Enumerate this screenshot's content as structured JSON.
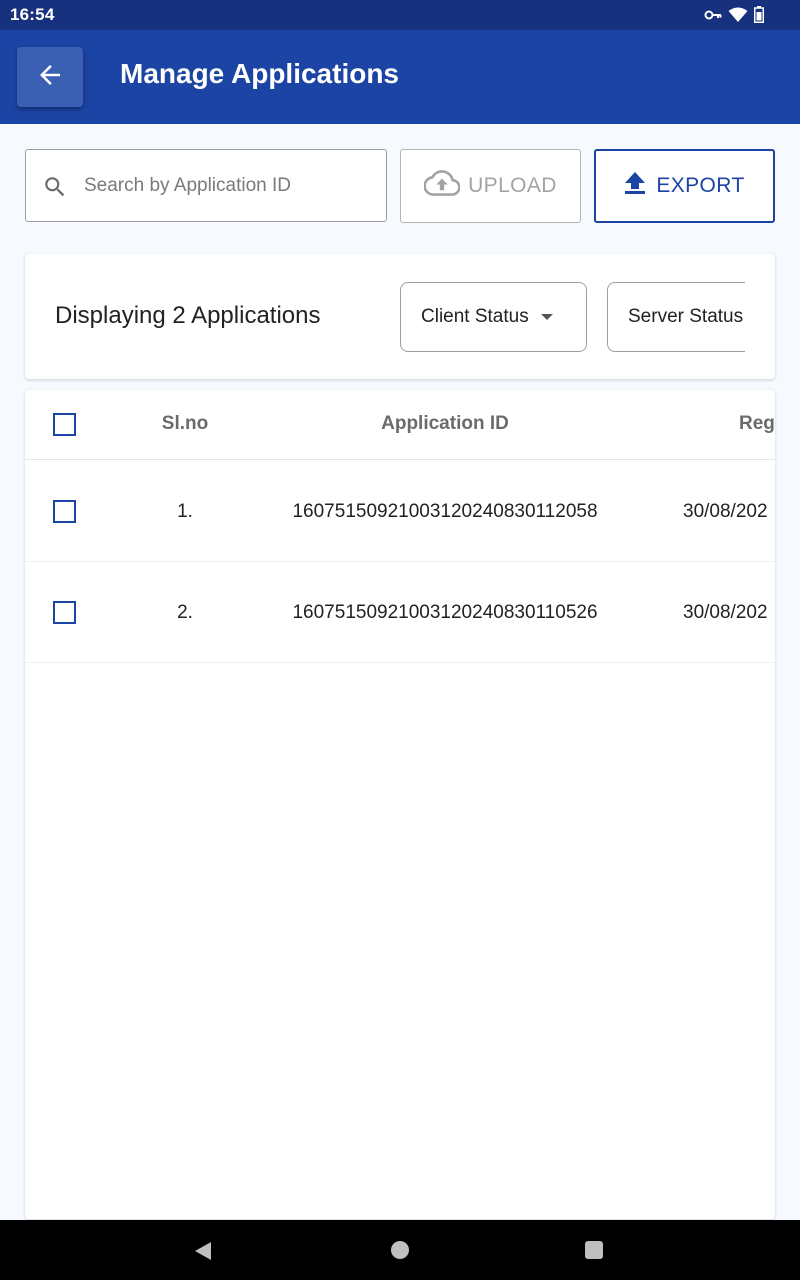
{
  "status_bar": {
    "time": "16:54",
    "icons": [
      "vpn-key-icon",
      "wifi-icon",
      "battery-icon"
    ]
  },
  "app_bar": {
    "title": "Manage Applications",
    "back_icon": "arrow-left-icon"
  },
  "toolbar": {
    "search_placeholder": "Search by Application ID",
    "search_value": "",
    "upload_label": "UPLOAD",
    "export_label": "EXPORT"
  },
  "filters": {
    "display_count": "Displaying 2 Applications",
    "client_status": "Client Status",
    "server_status": "Server Status"
  },
  "table": {
    "columns": [
      "Sl.no",
      "Application ID",
      "Reg"
    ],
    "rows": [
      {
        "slno": "1.",
        "app_id": "160751509210031202408301120​58",
        "reg": "30/08/202"
      },
      {
        "slno": "2.",
        "app_id": "160751509210031202408301105​26",
        "reg": "30/08/202"
      }
    ]
  },
  "colors": {
    "primary": "#1c44a4",
    "status_bar": "#17317e",
    "background": "#f6f9fd"
  }
}
